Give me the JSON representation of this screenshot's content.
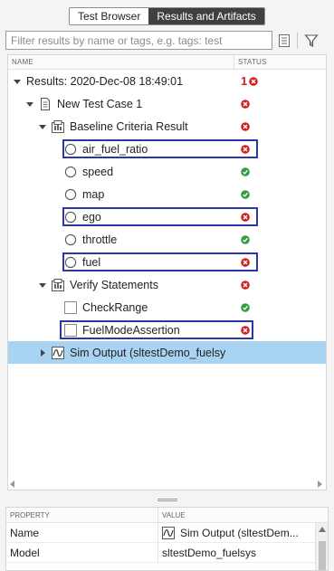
{
  "tabs": [
    {
      "label": "Test Browser",
      "active": false
    },
    {
      "label": "Results and Artifacts",
      "active": true
    }
  ],
  "search": {
    "placeholder": "Filter results by name or tags, e.g. tags: test",
    "value": ""
  },
  "tree": {
    "columns": {
      "name": "NAME",
      "status": "STATUS"
    },
    "rows": [
      {
        "label": "Results: 2020-Dec-08 18:49:01",
        "icon": "none",
        "caret": "down",
        "status": "fail",
        "fail_count": "1"
      },
      {
        "label": "New Test Case 1",
        "icon": "document-icon",
        "caret": "down",
        "status": "fail"
      },
      {
        "label": "Baseline Criteria Result",
        "icon": "criteria-icon",
        "caret": "down",
        "status": "fail"
      },
      {
        "label": "air_fuel_ratio",
        "icon": "signal-circle-icon",
        "caret": "none",
        "status": "fail",
        "highlighted": true
      },
      {
        "label": "speed",
        "icon": "signal-circle-icon",
        "caret": "none",
        "status": "pass"
      },
      {
        "label": "map",
        "icon": "signal-circle-icon",
        "caret": "none",
        "status": "pass"
      },
      {
        "label": "ego",
        "icon": "signal-circle-icon",
        "caret": "none",
        "status": "fail",
        "highlighted": true
      },
      {
        "label": "throttle",
        "icon": "signal-circle-icon",
        "caret": "none",
        "status": "pass"
      },
      {
        "label": "fuel",
        "icon": "signal-circle-icon",
        "caret": "none",
        "status": "fail",
        "highlighted": true
      },
      {
        "label": "Verify Statements",
        "icon": "criteria-icon",
        "caret": "down",
        "status": "fail"
      },
      {
        "label": "CheckRange",
        "icon": "checkbox-icon",
        "caret": "none",
        "status": "pass"
      },
      {
        "label": "FuelModeAssertion",
        "icon": "checkbox-icon",
        "caret": "none",
        "status": "fail",
        "highlighted": true
      },
      {
        "label": "Sim Output (sltestDemo_fuelsy",
        "icon": "sim-output-icon",
        "caret": "right",
        "status": "none",
        "selected": true
      }
    ]
  },
  "properties": {
    "columns": {
      "name": "PROPERTY",
      "value": "VALUE"
    },
    "rows": [
      {
        "name": "Name",
        "value": "Sim Output (sltestDem...",
        "icon": "sim-output-icon"
      },
      {
        "name": "Model",
        "value": "sltestDemo_fuelsys"
      }
    ]
  },
  "colors": {
    "selection": "#a9d3f2",
    "fail": "#d31d1d",
    "pass": "#2e9e3e",
    "highlight_border": "#2c36a8",
    "active_tab": "#404040"
  }
}
